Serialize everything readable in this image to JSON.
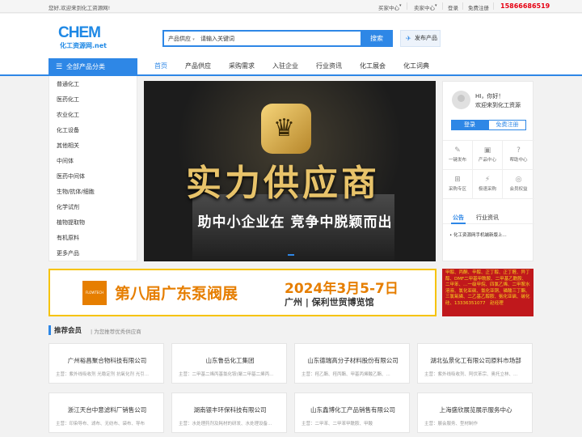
{
  "topbar": {
    "welcome": "您好,欢迎来到化工资源网!",
    "buyer_center": "买家中心",
    "seller_center": "卖家中心",
    "login": "登录",
    "register": "免费注册",
    "phone": "15866686519"
  },
  "logo": {
    "main": "CHEM",
    "sub": "化工资源网.net"
  },
  "search": {
    "category": "产品供应",
    "placeholder": "请输入关键词",
    "button": "搜索"
  },
  "publish_button": "发布产品",
  "nav": {
    "all_categories": "全部产品分类",
    "items": [
      "首页",
      "产品供应",
      "采购需求",
      "入驻企业",
      "行业资讯",
      "化工展会",
      "化工词典"
    ]
  },
  "categories": [
    "普通化工",
    "医药化工",
    "农业化工",
    "化工设备",
    "其他相关",
    "中间体",
    "医药中间体",
    "生物/抗体/细胞",
    "化学试剂",
    "植物提取物",
    "有机原料",
    "更多产品"
  ],
  "banner": {
    "title": "实力供应商",
    "subtitle": "助中小企业在 竞争中脱颖而出"
  },
  "user_panel": {
    "greeting": "HI，你好！",
    "welcome": "欢迎来到化工资源",
    "login": "登录",
    "register": "免费注册",
    "shortcuts": [
      {
        "label": "一键发布",
        "icon": "edit-icon"
      },
      {
        "label": "产品中心",
        "icon": "box-icon"
      },
      {
        "label": "帮助中心",
        "icon": "help-icon"
      },
      {
        "label": "采购专区",
        "icon": "cart-icon"
      },
      {
        "label": "极速采购",
        "icon": "bolt-icon"
      },
      {
        "label": "会员权益",
        "icon": "vip-icon"
      }
    ],
    "tabs": [
      "公告",
      "行业资讯"
    ],
    "news": [
      "化工资源网手机端新版上..."
    ]
  },
  "ad_expo": {
    "brand": "FLOWTECH",
    "title": "第八届广东泵阀展",
    "dates": "2024年3月5-7日",
    "venue": "广州 | 保利世贸博览馆"
  },
  "ad_side": {
    "text": "甲醇、丙酮、辛醇、正丁醇、正丁醛、异丁醇、DMF二甲基甲酰胺、二甲基乙酰胺、二甲苯、…一级甲烷、四氯乙烯、二甲胺水溶液、氯化亚砜、氯化亚铜、磷酸三丁酯、三氯氧磷、二乙基乙醇胺、氨化亚砜、碳化硅、13336351077",
    "contact": "赵经理"
  },
  "section": {
    "title": "推荐会员",
    "subtitle": "为您推荐优秀供应商"
  },
  "members": [
    {
      "name": "广州裕昌聚合物科技有限公司",
      "main": "主营：紫外线吸收剂 光稳定剂 抗氧化剂 光引..."
    },
    {
      "name": "山东鲁岳化工集团",
      "main": "主营：二甲基二烯丙基氯化铵(聚二甲基二烯丙..."
    },
    {
      "name": "山东德瑞高分子材料股份有限公司",
      "main": "主营：羟乙酯、羟丙酯、甲基丙烯酸乙酯、..."
    },
    {
      "name": "湖北弘景化工有限公司原料市场部",
      "main": "主营：紫外线吸收剂、阿伏苯宗、奥托立林、..."
    },
    {
      "name": "浙江天台中意滤料厂销售公司",
      "main": "主营：印染导布、滤布、无纺布、袋布、导布"
    },
    {
      "name": "湖南银丰环保科技有限公司",
      "main": "主营：水处理药剂及耗材的研发、水处理设备..."
    },
    {
      "name": "山东鑫博化工产品销售有限公司",
      "main": "主营：二甲苯、二甲苯甲酰胺、甲酸"
    },
    {
      "name": "上海盛欣展览展示服务中心",
      "main": "主营：展会服务、型材制作"
    }
  ]
}
